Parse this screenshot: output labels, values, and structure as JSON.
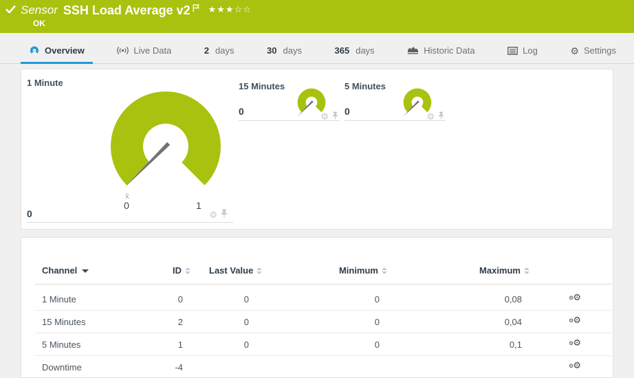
{
  "header": {
    "kind_label": "Sensor",
    "title": "SSH Load Average v2",
    "status": "OK",
    "rating_stars": "★★★☆☆",
    "rating_filled": 3,
    "rating_total": 5
  },
  "tabs": [
    {
      "label": "Overview",
      "icon": "gauge-icon",
      "active": true
    },
    {
      "label": "Live Data",
      "icon": "live-data-icon",
      "active": false
    },
    {
      "num": "2",
      "label": "days",
      "active": false
    },
    {
      "num": "30",
      "label": "days",
      "active": false
    },
    {
      "num": "365",
      "label": "days",
      "active": false
    },
    {
      "label": "Historic Data",
      "icon": "historic-data-icon",
      "active": false
    },
    {
      "label": "Log",
      "icon": "log-icon",
      "active": false
    },
    {
      "label": "Settings",
      "icon": "settings-gear-icon",
      "active": false
    }
  ],
  "colors": {
    "status_green": "#a8c20f",
    "active_tab_blue": "#1f9ad7",
    "needle_gray": "#737373"
  },
  "gauge_panel": {
    "primary": {
      "title": "1 Minute",
      "value": "0",
      "scale_min": "0",
      "scale_max": "1",
      "avg_marker": "x̄"
    },
    "mini": [
      {
        "title": "15 Minutes",
        "value": "0"
      },
      {
        "title": "5 Minutes",
        "value": "0"
      }
    ],
    "footer_icons": [
      "settings-gear",
      "pin"
    ]
  },
  "table": {
    "columns": [
      {
        "label": "Channel",
        "sort": "active-desc"
      },
      {
        "label": "ID",
        "sort": "none"
      },
      {
        "label": "Last Value",
        "sort": "none"
      },
      {
        "label": "Minimum",
        "sort": "none"
      },
      {
        "label": "Maximum",
        "sort": "none"
      }
    ],
    "rows": [
      {
        "channel": "1 Minute",
        "id": "0",
        "last_value": "0",
        "minimum": "0",
        "maximum": "0,08"
      },
      {
        "channel": "15 Minutes",
        "id": "2",
        "last_value": "0",
        "minimum": "0",
        "maximum": "0,04"
      },
      {
        "channel": "5 Minutes",
        "id": "1",
        "last_value": "0",
        "minimum": "0",
        "maximum": "0,1"
      },
      {
        "channel": "Downtime",
        "id": "-4",
        "last_value": "",
        "minimum": "",
        "maximum": ""
      }
    ]
  }
}
